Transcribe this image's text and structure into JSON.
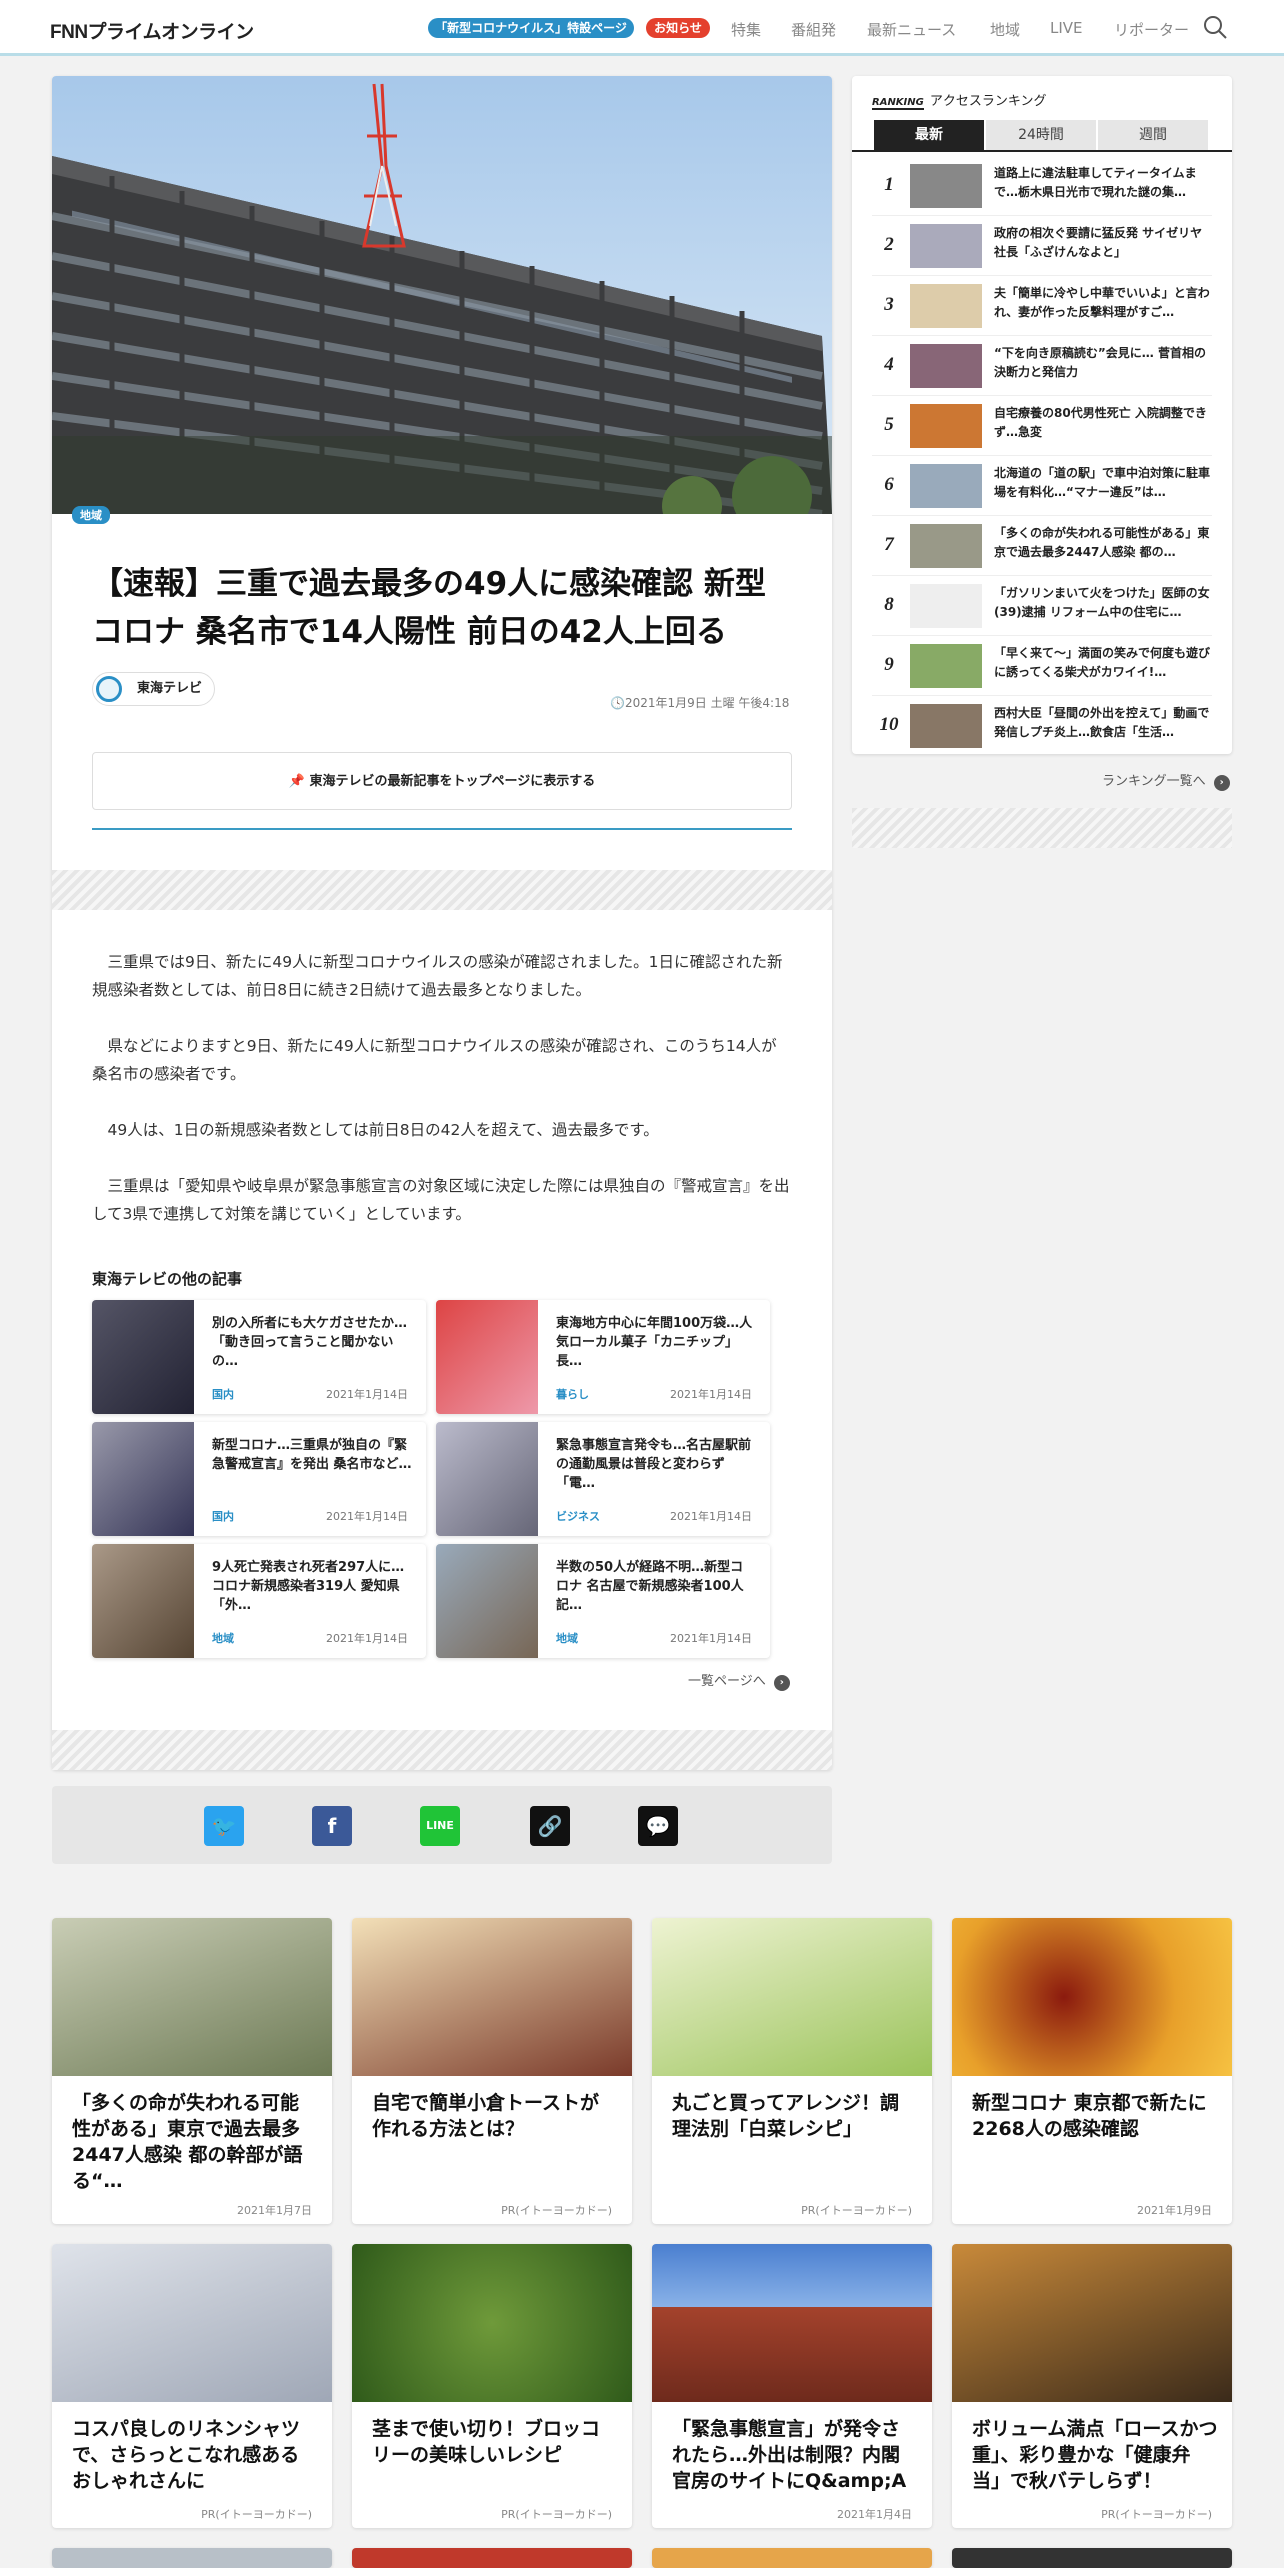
{
  "header": {
    "logo": "FNNプライムオンライン",
    "covid_pill": "「新型コロナウイルス」特設ページ",
    "notice_pill": "お知らせ",
    "nav": [
      "特集",
      "番組発",
      "最新ニュース",
      "地域",
      "LIVE",
      "リポーター"
    ]
  },
  "article": {
    "category": "地域",
    "title": "【速報】三重で過去最多の49人に感染確認 新型コロナ 桑名市で14人陽性 前日の42人上回る",
    "source": "東海テレビ",
    "date": "2021年1月9日 土曜 午後4:18",
    "pin_button": "東海テレビの最新記事をトップページに表示する",
    "paragraphs": [
      "三重県では9日、新たに49人に新型コロナウイルスの感染が確認されました。1日に確認された新規感染者数としては、前日8日に続き2日続けて過去最多となりました。",
      "県などによりますと9日、新たに49人に新型コロナウイルスの感染が確認され、このうち14人が桑名市の感染者です。",
      "49人は、1日の新規感染者数としては前日8日の42人を超えて、過去最多です。",
      "三重県は「愛知県や岐阜県が緊急事態宣言の対象区域に決定した際には県独自の『警戒宣言』を出して3県で連携して対策を講じていく」としています。"
    ]
  },
  "related": {
    "heading": "東海テレビの他の記事",
    "items": [
      {
        "title": "別の入所者にも大ケガさせたか…「動き回って言うこと聞かないの…",
        "cat": "国内",
        "date": "2021年1月14日"
      },
      {
        "title": "東海地方中心に年間100万袋…人気ローカル菓子「カニチップ」 長…",
        "cat": "暮らし",
        "date": "2021年1月14日"
      },
      {
        "title": "新型コロナ…三重県が独自の『緊急警戒宣言』を発出 桑名市など…",
        "cat": "国内",
        "date": "2021年1月14日"
      },
      {
        "title": "緊急事態宣言発令も…名古屋駅前の通勤風景は普段と変わらず「電…",
        "cat": "ビジネス",
        "date": "2021年1月14日"
      },
      {
        "title": "9人死亡発表され死者297人に…コロナ新規感染者319人 愛知県「外…",
        "cat": "地域",
        "date": "2021年1月14日"
      },
      {
        "title": "半数の50人が経路不明…新型コロナ 名古屋で新規感染者100人 記…",
        "cat": "地域",
        "date": "2021年1月14日"
      }
    ],
    "more": "一覧ページへ"
  },
  "ranking": {
    "label_en": "RANKING",
    "label": "アクセスランキング",
    "tabs": [
      "最新",
      "24時間",
      "週間"
    ],
    "items": [
      "道路上に違法駐車してティータイムまで…栃木県日光市で現れた謎の集…",
      "政府の相次ぐ要請に猛反発 サイゼリヤ社長「ふざけんなよと」",
      "夫「簡単に冷やし中華でいいよ」と言われ、妻が作った反撃料理がすご…",
      "“下を向き原稿読む”会見に… 菅首相の決断力と発信力",
      "自宅療養の80代男性死亡 入院調整できず…急変",
      "北海道の「道の駅」で車中泊対策に駐車場を有料化…“マナー違反”は…",
      "「多くの命が失われる可能性がある」東京で過去最多2447人感染 都の…",
      "「ガソリンまいて火をつけた」医師の女(39)逮捕 リフォーム中の住宅に…",
      "「早く来て～」満面の笑みで何度も遊びに誘ってくる柴犬がカワイイ!…",
      "西村大臣「昼間の外出を控えて」動画で発信しプチ炎上…飲食店「生活…"
    ],
    "more": "ランキング一覧へ"
  },
  "grid": [
    {
      "title": "「多くの命が失われる可能性がある」東京で過去最多2447人感染 都の幹部が語る“…",
      "meta": "2021年1月7日"
    },
    {
      "title": "自宅で簡単小倉トーストが作れる方法とは？",
      "meta": "PR(イトーヨーカドー)"
    },
    {
      "title": "丸ごと買ってアレンジ！調理法別「白菜レシピ」",
      "meta": "PR(イトーヨーカドー)"
    },
    {
      "title": "新型コロナ 東京都で新たに2268人の感染確認",
      "meta": "2021年1月9日"
    },
    {
      "title": "コスパ良しのリネンシャツで、さらっとこなれ感あるおしゃれさんに",
      "meta": "PR(イトーヨーカドー)"
    },
    {
      "title": "茎まで使い切り！ブロッコリーの美味しいレシピ",
      "meta": "PR(イトーヨーカドー)"
    },
    {
      "title": "「緊急事態宣言」が発令されたら…外出は制限？内閣官房のサイトにQ&amp;A",
      "meta": "2021年1月4日"
    },
    {
      "title": "ボリューム満点「ロースかつ重」、彩り豊かな「健康弁当」で秋バテしらず！",
      "meta": "PR(イトーヨーカドー)"
    }
  ]
}
